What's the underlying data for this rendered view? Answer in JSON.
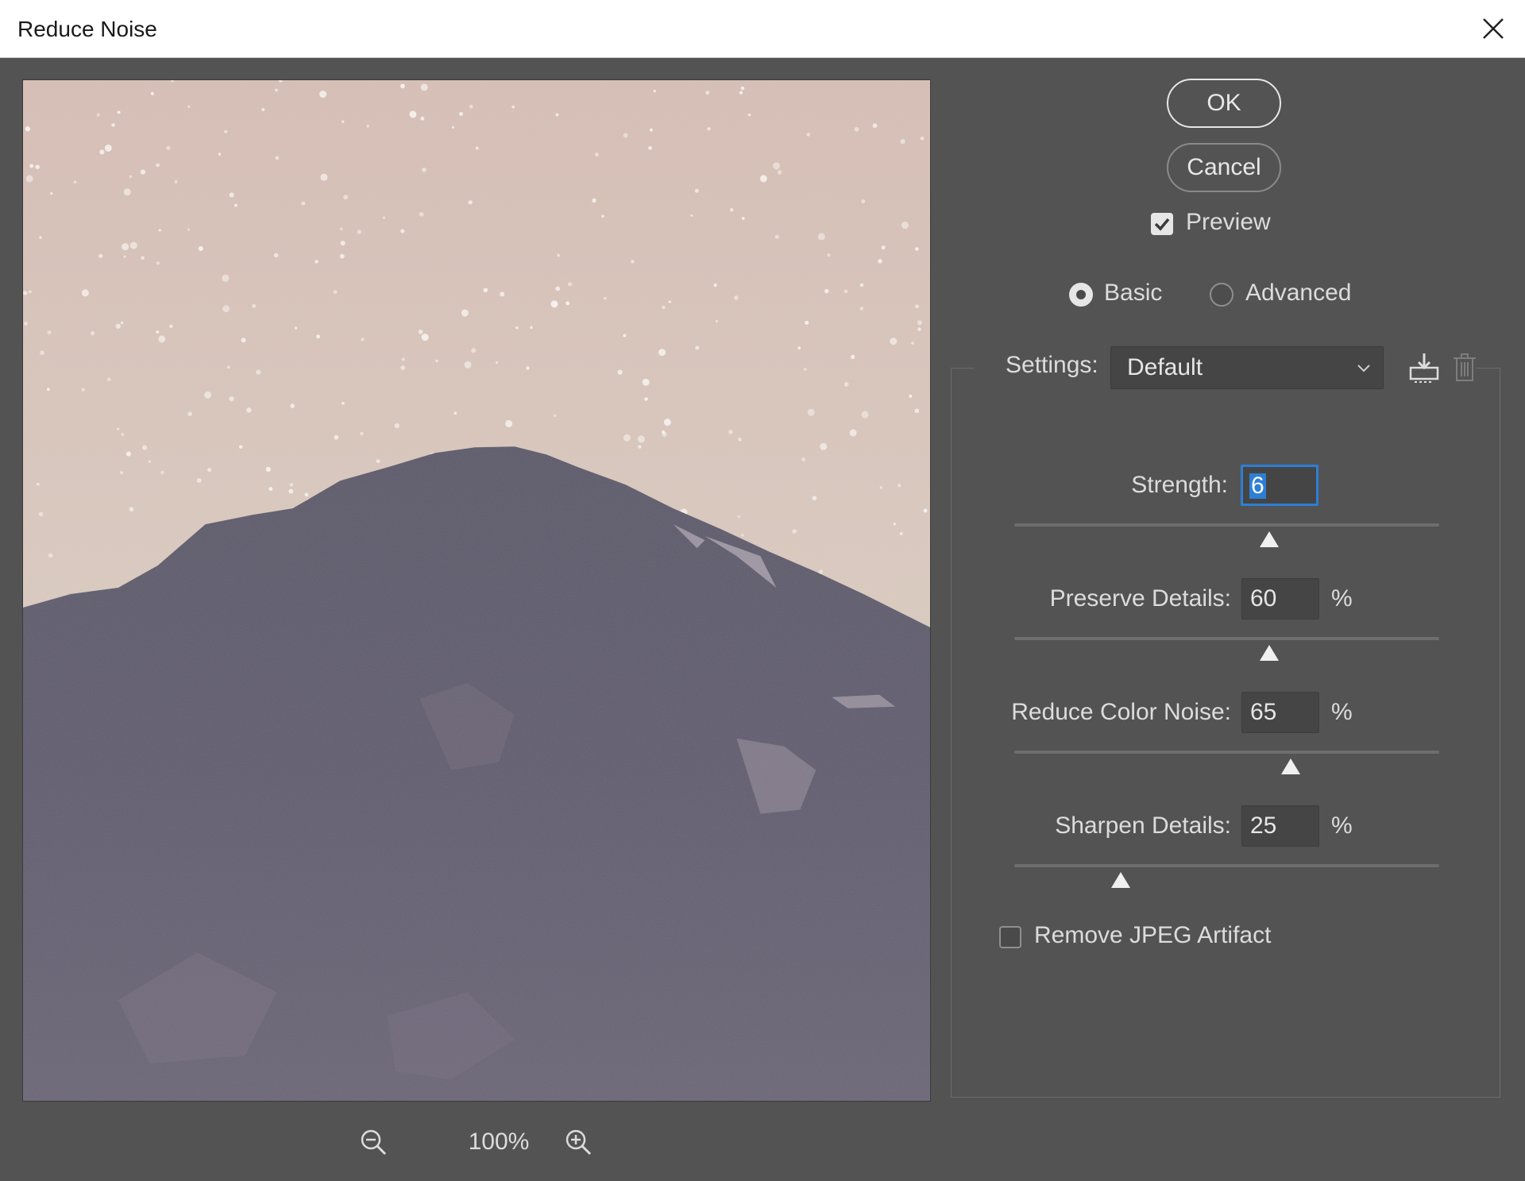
{
  "window": {
    "title": "Reduce Noise"
  },
  "zoom": {
    "level": "100%"
  },
  "buttons": {
    "ok": "OK",
    "cancel": "Cancel"
  },
  "preview_checkbox": {
    "label": "Preview",
    "checked": true
  },
  "mode": {
    "options": [
      "Basic",
      "Advanced"
    ],
    "selected": "Basic"
  },
  "settings": {
    "label": "Settings:",
    "value": "Default"
  },
  "sliders": [
    {
      "label": "Strength:",
      "value": "6",
      "unit": "",
      "max": 10,
      "focused": true
    },
    {
      "label": "Preserve Details:",
      "value": "60",
      "unit": "%",
      "max": 100
    },
    {
      "label": "Reduce Color Noise:",
      "value": "65",
      "unit": "%",
      "max": 100
    },
    {
      "label": "Sharpen Details:",
      "value": "25",
      "unit": "%",
      "max": 100
    }
  ],
  "jpeg_checkbox": {
    "label": "Remove JPEG Artifact",
    "checked": false
  },
  "colors": {
    "dialog_bg": "#535353",
    "focus_blue": "#2d7fd6",
    "sky": "#d9c8bd",
    "mountain": "#5e5a6b"
  }
}
